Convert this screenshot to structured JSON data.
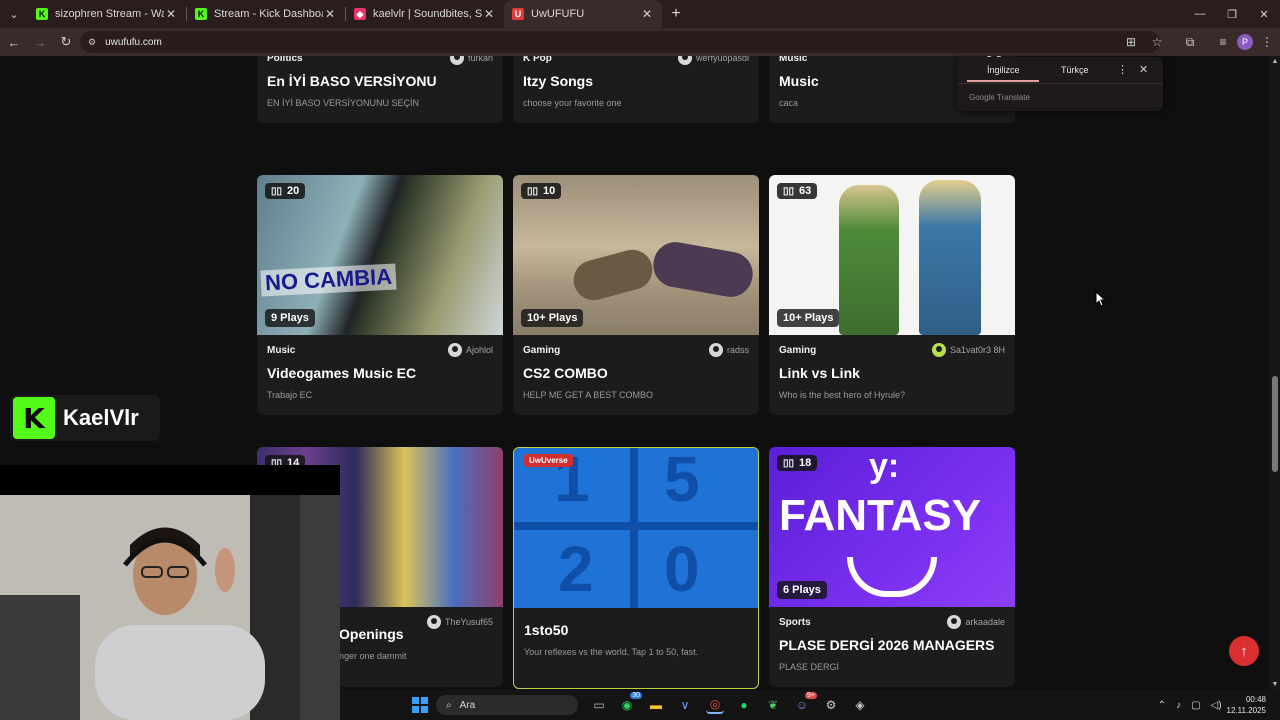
{
  "browser": {
    "tabs": [
      {
        "title": "sizophren Stream - Watch Live",
        "favicon": "kick-icon",
        "color": "#53fc18"
      },
      {
        "title": "Stream - Kick Dashboard",
        "favicon": "kick-icon",
        "color": "#53fc18"
      },
      {
        "title": "kaelvlr | Soundbites, Sounds M",
        "favicon": "soundbites-icon",
        "color": "#e8336b"
      },
      {
        "title": "UwUFUFU",
        "favicon": "uwufufu-icon",
        "color": "#e03b3b"
      }
    ],
    "url": "uwufufu.com",
    "profile_initial": "P"
  },
  "translate_popup": {
    "tab_source": "İngilizce",
    "tab_target": "Türkçe",
    "footer": "Google Translate"
  },
  "rows": [
    [
      {
        "category": "Politics",
        "author": "furkan",
        "title": "En İYİ BASO VERSİYONU",
        "description": "EN İYİ BASO VERSİYONUNU SEÇİN"
      },
      {
        "category": "K Pop",
        "author": "werfyuopasdl",
        "title": "Itzy Songs",
        "description": "choose your favorite one"
      },
      {
        "category": "Music",
        "author": "",
        "title": "Music",
        "description": "caca"
      }
    ],
    [
      {
        "count": "20",
        "plays": "9 Plays",
        "category": "Music",
        "author": "Ajohlol",
        "title": "Videogames Music EC",
        "description": "Trabajo EC"
      },
      {
        "count": "10",
        "plays": "10+ Plays",
        "category": "Gaming",
        "author": "radss",
        "title": "CS2 COMBO",
        "description": "HELP ME GET A BEST COMBO"
      },
      {
        "count": "63",
        "plays": "10+ Plays",
        "category": "Gaming",
        "author": "Sa1vat0r3 8H",
        "title": "Link vs Link",
        "description": "Who is the best hero of Hyrule?"
      }
    ],
    [
      {
        "count": "14",
        "category": "",
        "author": "TheYusuf65",
        "title": "Openings",
        "description": "nger one dammit"
      },
      {
        "badge": "UwUverse",
        "thumb_text": [
          "1",
          "5",
          "2",
          "0"
        ],
        "title": "1sto50",
        "description": "Your reflexes vs the world. Tap 1 to 50, fast."
      },
      {
        "count": "18",
        "plays": "6 Plays",
        "thumb_text": [
          "y:",
          "FANTASY"
        ],
        "category": "Sports",
        "author": "arkaadale",
        "title": "PLASE DERGİ 2026 MANAGERS",
        "description": "PLASE DERGİ"
      }
    ]
  ],
  "overlay": {
    "kick_logo": "K",
    "kick_name": "KaelVlr"
  },
  "taskbar": {
    "search_label": "Ara",
    "whatsapp_badge": "30",
    "discord_badge": "9+",
    "time": "00:48",
    "date": "12.11.2025"
  },
  "colors": {
    "accent_red": "#d92f2f",
    "kick_green": "#53fc18",
    "card_bg": "#1c1c1d",
    "page_bg": "#0f0f10"
  }
}
